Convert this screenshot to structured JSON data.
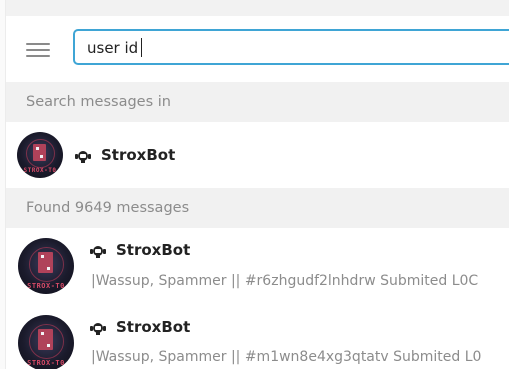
{
  "search": {
    "value": "user id"
  },
  "sections": {
    "search_in": "Search messages in",
    "found": "Found 9649 messages"
  },
  "chat": {
    "name": "StroxBot",
    "avatar_tag": "STROX-T0",
    "icon": "bot-icon"
  },
  "results": [
    {
      "name": "StroxBot",
      "avatar_tag": "STROX-T0",
      "preview": "|Wassup, Spammer || #r6zhgudf2lnhdrw Submited L0C"
    },
    {
      "name": "StroxBot",
      "avatar_tag": "STROX-T0",
      "preview": "|Wassup, Spammer || #m1wn8e4xg3qtatv Submited L0"
    }
  ],
  "colors": {
    "accent": "#3fa5d5",
    "section_bg": "#f1f1f1",
    "muted_text": "#8c8c8c",
    "name_text": "#222222",
    "avatar_accent": "#b0425a"
  }
}
